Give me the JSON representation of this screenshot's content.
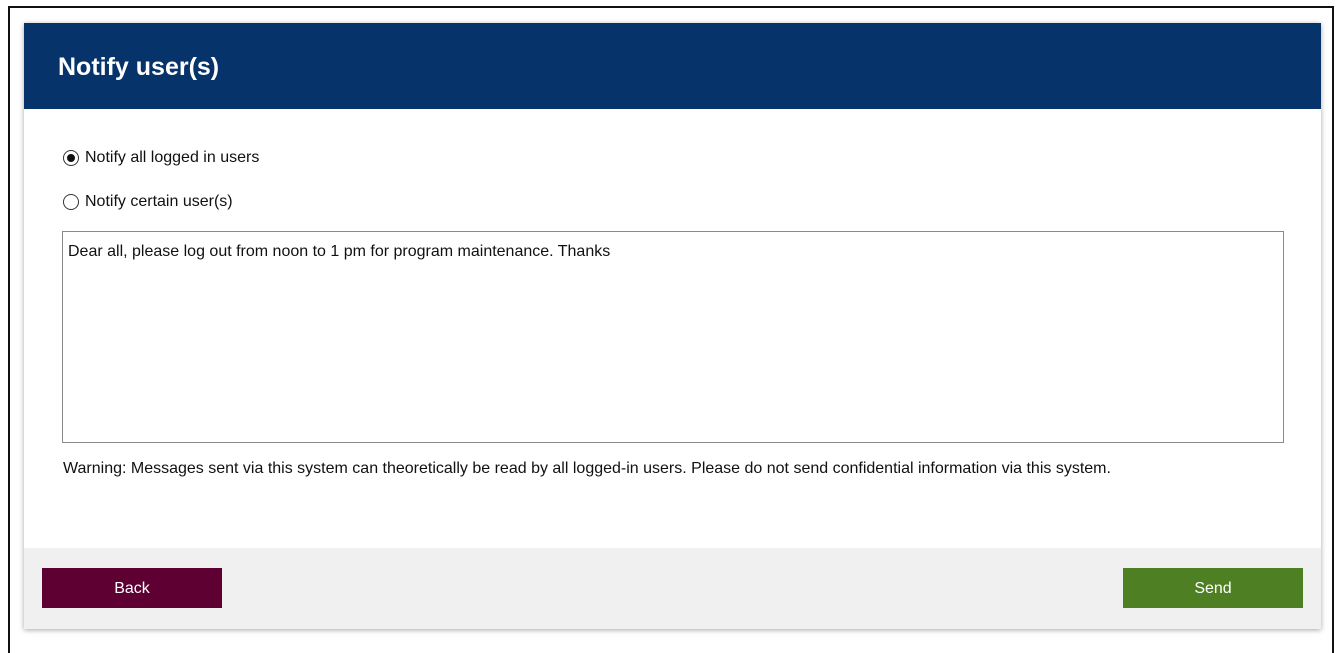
{
  "dialog": {
    "title": "Notify user(s)"
  },
  "options": [
    {
      "label": "Notify all logged in users",
      "checked": true
    },
    {
      "label": "Notify certain user(s)",
      "checked": false
    }
  ],
  "message": {
    "value": "Dear all, please log out from noon to 1 pm for program maintenance. Thanks"
  },
  "warning": "Warning: Messages sent via this system can theoretically be read by all logged-in users. Please do not send confidential information via this system.",
  "footer": {
    "back_label": "Back",
    "send_label": "Send"
  },
  "colors": {
    "header": "#07336b",
    "back_button": "#5e0032",
    "send_button": "#4e7f22"
  }
}
